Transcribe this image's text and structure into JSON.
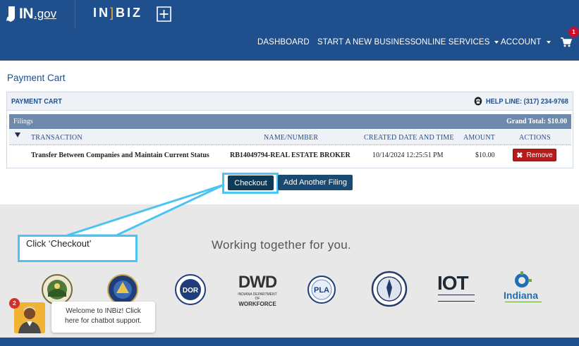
{
  "header": {
    "ingov_in": "IN",
    "ingov_gov": ".gov",
    "inbiz_left": "IN",
    "inbiz_bracket": "]",
    "inbiz_right": "BIZ"
  },
  "nav": {
    "items": [
      {
        "label": "DASHBOARD",
        "dropdown": false
      },
      {
        "label": "START A NEW BUSINESS",
        "dropdown": false
      },
      {
        "label": "ONLINE SERVICES",
        "dropdown": true
      },
      {
        "label": "ACCOUNT",
        "dropdown": true
      }
    ],
    "cart_icon": "shopping-cart-icon",
    "cart_count": "1"
  },
  "page": {
    "title": "Payment Cart"
  },
  "cart": {
    "panel_title": "PAYMENT CART",
    "helpline_icon": "phone-icon",
    "helpline": "HELP LINE: (317) 234-9768",
    "filings_label": "Filings",
    "grand_total": "Grand Total: $10.00",
    "columns": {
      "transaction": "TRANSACTION",
      "name_number": "NAME/NUMBER",
      "created": "CREATED DATE AND TIME",
      "amount": "AMOUNT",
      "actions": "ACTIONS"
    },
    "rows": [
      {
        "transaction": "Transfer Between Companies and Maintain Current Status",
        "name_number": "RB14049794-REAL ESTATE BROKER",
        "created": "10/14/2024 12:25:51 PM",
        "amount": "$10.00",
        "action_label": "Remove"
      }
    ]
  },
  "actions": {
    "checkout": "Checkout",
    "add_another": "Add Another Filing"
  },
  "callout": {
    "text": "Click ‘Checkout’"
  },
  "footer": {
    "tagline": "Working together for you.",
    "logos": [
      "state-seal-icon",
      "secretary-of-state-seal-icon",
      "dor-logo",
      "dwd-logo",
      "pla-logo",
      "attorney-general-seal-icon",
      "iot-logo",
      "indiana-sbdc-logo"
    ],
    "dwd": {
      "big": "DWD",
      "small": "INDIANA DEPARTMENT OF",
      "word": "WORKFORCE"
    },
    "dor": "DOR",
    "pla": "PLA",
    "iot": "IOT",
    "indiana": "Indiana"
  },
  "chat": {
    "badge": "2",
    "message": "Welcome to INBiz! Click here for chatbot support."
  },
  "colors": {
    "primary": "#1f4f8c",
    "accent_highlight": "#4cc3f0",
    "remove": "#b71c1c",
    "checkout": "#0f3a55"
  }
}
